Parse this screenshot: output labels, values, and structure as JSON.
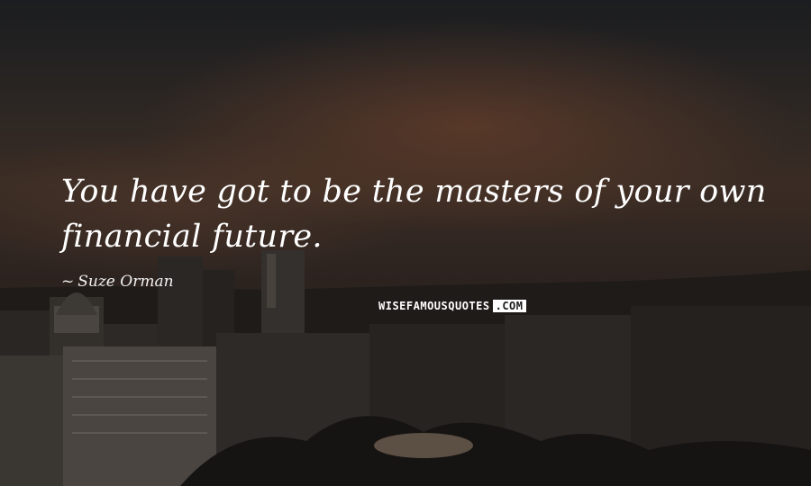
{
  "quote": {
    "text": "You have got to be the masters of your own financial future.",
    "author_prefix": "~",
    "author": "Suze Orman"
  },
  "watermark": {
    "brand": "WISEFAMOUSQUOTES",
    "tld": ".COM"
  },
  "colors": {
    "text": "#ffffff",
    "sky_warm": "#5a3a2a",
    "city_dark": "#1a1715"
  }
}
